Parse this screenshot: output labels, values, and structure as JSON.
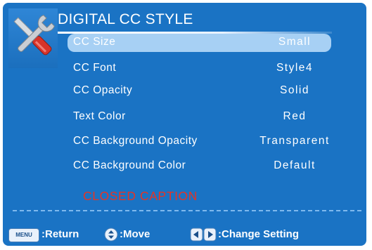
{
  "header": {
    "title": "DIGITAL CC STYLE",
    "icon": "tools-icon"
  },
  "menu": {
    "items": [
      {
        "label": "CC Size",
        "value": "Small",
        "selected": true
      },
      {
        "label": "CC Font",
        "value": "Style4",
        "selected": false
      },
      {
        "label": "CC Opacity",
        "value": "Solid",
        "selected": false
      },
      {
        "label": "Text Color",
        "value": "Red",
        "selected": false
      },
      {
        "label": "CC Background Opacity",
        "value": "Transparent",
        "selected": false
      },
      {
        "label": "CC Background Color",
        "value": "Default",
        "selected": false
      }
    ]
  },
  "preview": {
    "text": "CLOSED CAPTION",
    "color": "#e53425"
  },
  "footer": {
    "menu_key": "MENU",
    "return_label": ":Return",
    "move_label": ":Move",
    "change_label": ":Change Setting"
  },
  "colors": {
    "panel": "#1a73c4",
    "highlight": "#a7d0f4"
  }
}
